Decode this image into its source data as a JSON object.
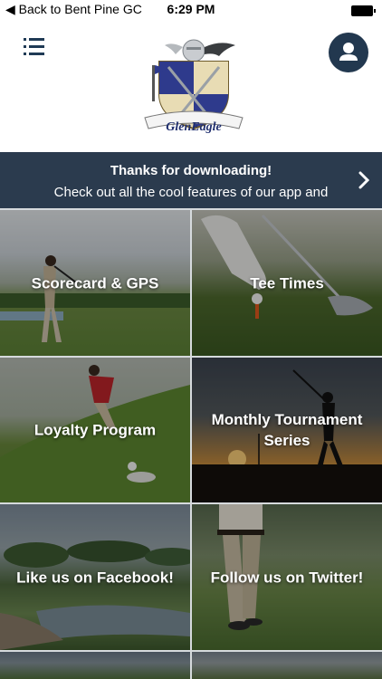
{
  "status_bar": {
    "back_label": "◀ Back to Bent Pine GC",
    "time": "6:29 PM"
  },
  "header": {
    "logo_text": "GlenEagle"
  },
  "banner": {
    "title": "Thanks for downloading!",
    "subtitle": "Check out all the cool features of our app and"
  },
  "tiles": [
    {
      "label": "Scorecard & GPS"
    },
    {
      "label": "Tee Times"
    },
    {
      "label": "Loyalty Program"
    },
    {
      "label": "Monthly Tournament Series"
    },
    {
      "label": "Like us on Facebook!"
    },
    {
      "label": "Follow us on Twitter!"
    }
  ],
  "colors": {
    "navy": "#22384f",
    "banner": "#2b3b4e",
    "divider": "#d6dadd"
  }
}
